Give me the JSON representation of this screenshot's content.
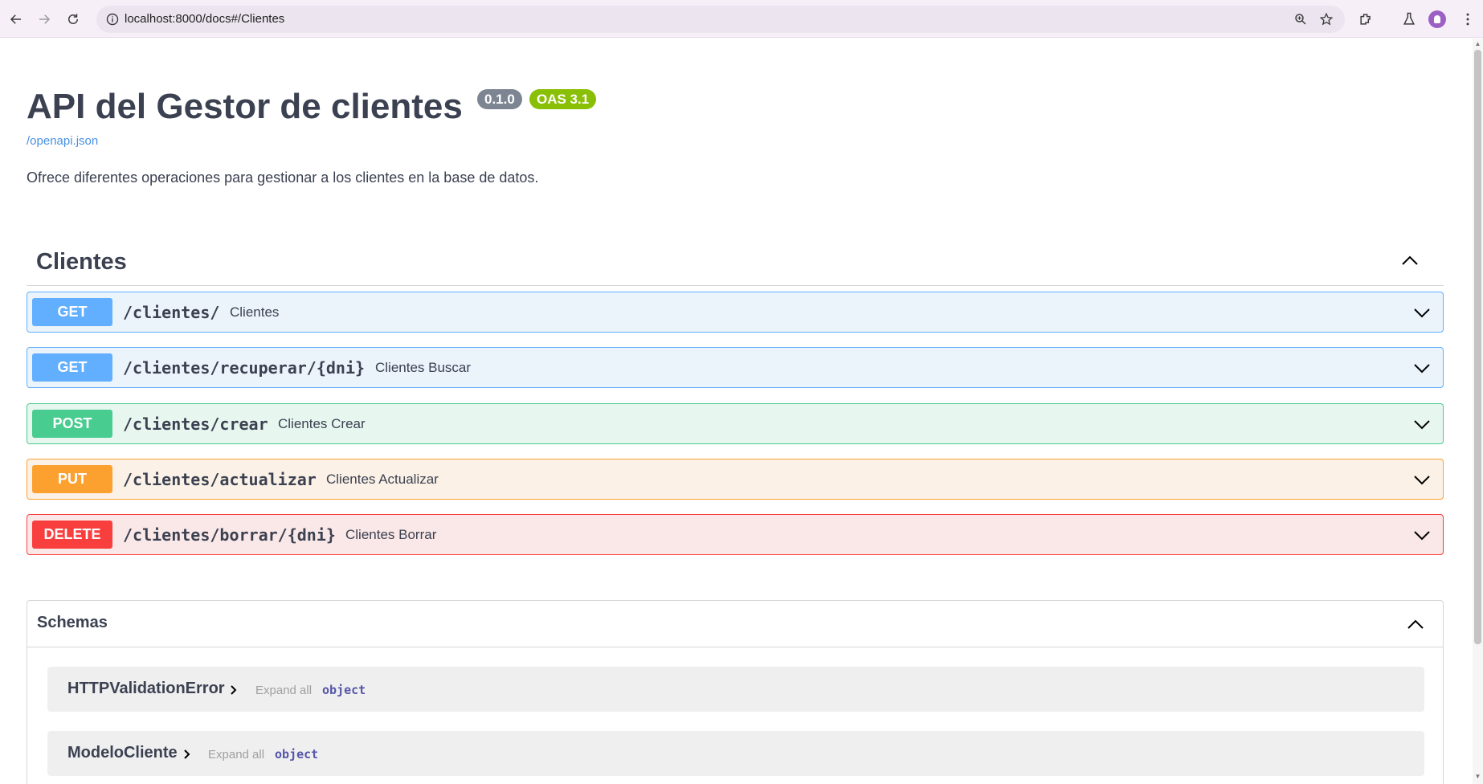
{
  "browser": {
    "url": "localhost:8000/docs#/Clientes"
  },
  "api": {
    "title": "API del Gestor de clientes",
    "version": "0.1.0",
    "oas": "OAS 3.1",
    "spec_link": "/openapi.json",
    "description": "Ofrece diferentes operaciones para gestionar a los clientes en la base de datos."
  },
  "tag": {
    "name": "Clientes"
  },
  "operations": [
    {
      "method": "GET",
      "path": "/clientes/",
      "summary": "Clientes"
    },
    {
      "method": "GET",
      "path": "/clientes/recuperar/{dni}",
      "summary": "Clientes Buscar"
    },
    {
      "method": "POST",
      "path": "/clientes/crear",
      "summary": "Clientes Crear"
    },
    {
      "method": "PUT",
      "path": "/clientes/actualizar",
      "summary": "Clientes Actualizar"
    },
    {
      "method": "DELETE",
      "path": "/clientes/borrar/{dni}",
      "summary": "Clientes Borrar"
    }
  ],
  "schemas": {
    "title": "Schemas",
    "models": [
      {
        "name": "HTTPValidationError",
        "expand": "Expand all",
        "type": "object"
      },
      {
        "name": "ModeloCliente",
        "expand": "Expand all",
        "type": "object"
      }
    ]
  },
  "colors": {
    "get": "#61affe",
    "post": "#49cc90",
    "put": "#fca130",
    "delete": "#f93e3e",
    "link": "#4990e2",
    "version_badge": "#7d8492",
    "oas_badge": "#89bf04"
  }
}
